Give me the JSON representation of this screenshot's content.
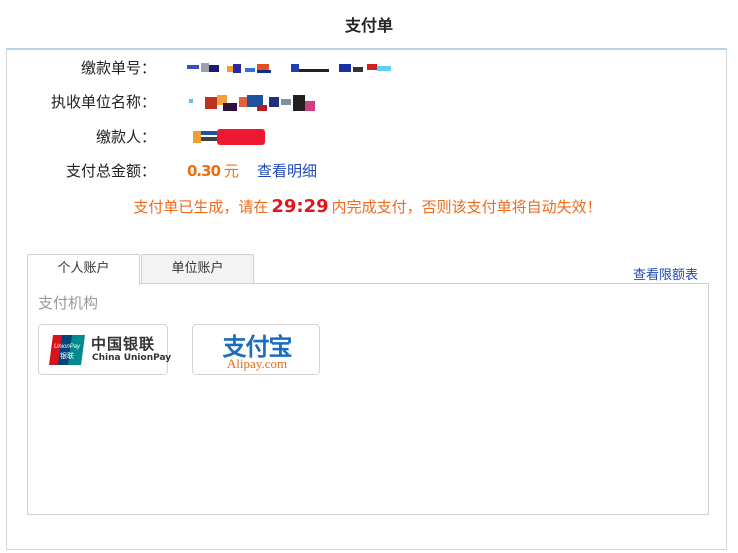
{
  "page_title": "支付单",
  "fields": {
    "order_no_label": "缴款单号：",
    "org_name_label": "执收单位名称：",
    "payer_label": "缴款人：",
    "total_label": "支付总金额：",
    "amount_redacted": "0.30",
    "currency": "元",
    "view_detail": "查看明细"
  },
  "notice": {
    "before": "支付单已生成，请在",
    "timer": "29:29",
    "after": "内完成支付，否则该支付单将自动失效！"
  },
  "tabs": [
    {
      "label": "个人账户",
      "active": true
    },
    {
      "label": "单位账户",
      "active": false
    }
  ],
  "limit_link": "查看限额表",
  "section_label": "支付机构",
  "payment_options": {
    "unionpay": {
      "badge_top": "UnionPay",
      "badge_bottom": "银联",
      "cn": "中国银联",
      "en": "China UnionPay"
    },
    "alipay": {
      "cn": "支付宝",
      "en": "Alipay.com"
    }
  },
  "colors": {
    "accent_orange": "#ef6a1a",
    "timer_red": "#e3161d",
    "link_blue": "#2148b8",
    "alipay_blue": "#1b6dc1"
  }
}
